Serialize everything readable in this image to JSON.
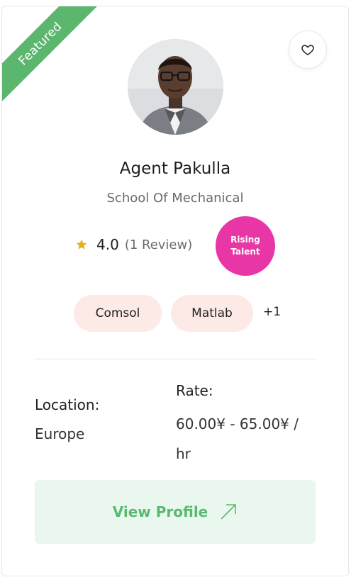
{
  "card": {
    "ribbon_label": "Featured",
    "name": "Agent Pakulla",
    "department": "School Of Mechanical",
    "rating": {
      "score": "4.0",
      "reviews": "(1 Review)"
    },
    "badge": {
      "line1": "Rising",
      "line2": "Talent"
    },
    "skills": [
      "Comsol",
      "Matlab"
    ],
    "more_skills": "+1",
    "location": {
      "label": "Location:",
      "value": "Europe"
    },
    "rate": {
      "label": "Rate:",
      "value": "60.00¥ - 65.00¥ / hr"
    },
    "button_label": "View Profile"
  },
  "colors": {
    "ribbon": "#5cb76e",
    "badge": "#e936a7",
    "skill_bg": "#fde9e5",
    "button_bg": "#eaf7ef",
    "button_text": "#58b96f",
    "star": "#e6b01e"
  },
  "icons": {
    "favorite": "heart-outline-icon",
    "rating": "star-icon",
    "button": "arrow-up-right-icon"
  }
}
